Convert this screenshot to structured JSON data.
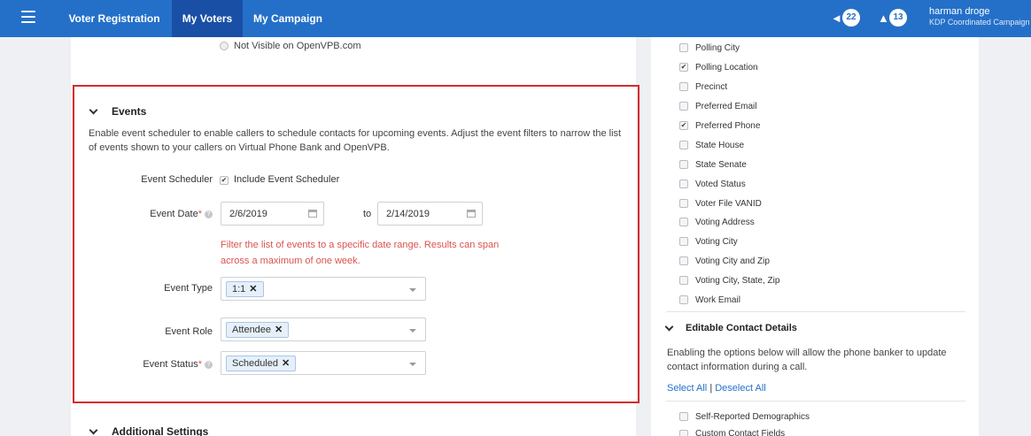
{
  "nav": {
    "tabs": [
      {
        "label": "Voter Registration"
      },
      {
        "label": "My Voters"
      },
      {
        "label": "My Campaign"
      }
    ],
    "notifications": {
      "announcements_count": "22",
      "alerts_count": "13"
    },
    "user": {
      "name": "harman droge",
      "org": "KDP Coordinated Campaign"
    }
  },
  "top_partial": {
    "radio_label": "Not Visible on OpenVPB.com"
  },
  "events": {
    "title": "Events",
    "description": "Enable event scheduler to enable callers to schedule contacts for upcoming events. Adjust the event filters to narrow the list of events shown to your callers on Virtual Phone Bank and OpenVPB.",
    "scheduler_label": "Event Scheduler",
    "scheduler_checkbox_label": "Include Event Scheduler",
    "date_label": "Event Date",
    "required_mark": "*",
    "start_date": "2/6/2019",
    "to_label": "to",
    "end_date": "2/14/2019",
    "date_help": "Filter the list of events to a specific date range. Results can span across a maximum of one week.",
    "type_label": "Event Type",
    "type_tag": "1:1",
    "role_label": "Event Role",
    "role_tag": "Attendee",
    "status_label": "Event Status",
    "status_tag": "Scheduled",
    "tag_remove": "✕"
  },
  "additional": {
    "title": "Additional Settings"
  },
  "right": {
    "fields": [
      {
        "label": "Polling City",
        "checked": false
      },
      {
        "label": "Polling Location",
        "checked": true
      },
      {
        "label": "Precinct",
        "checked": false
      },
      {
        "label": "Preferred Email",
        "checked": false
      },
      {
        "label": "Preferred Phone",
        "checked": true
      },
      {
        "label": "State House",
        "checked": false
      },
      {
        "label": "State Senate",
        "checked": false
      },
      {
        "label": "Voted Status",
        "checked": false
      },
      {
        "label": "Voter File VANID",
        "checked": false
      },
      {
        "label": "Voting Address",
        "checked": false
      },
      {
        "label": "Voting City",
        "checked": false
      },
      {
        "label": "Voting City and Zip",
        "checked": false
      },
      {
        "label": "Voting City, State, Zip",
        "checked": false
      },
      {
        "label": "Work Email",
        "checked": false
      }
    ],
    "editable": {
      "title": "Editable Contact Details",
      "description": "Enabling the options below will allow the phone banker to update contact information during a call.",
      "select_all": "Select All",
      "separator": "|",
      "deselect_all": "Deselect All",
      "items": [
        {
          "label": "Self-Reported Demographics",
          "checked": false
        },
        {
          "label": "Custom Contact Fields",
          "checked": false
        }
      ]
    }
  }
}
